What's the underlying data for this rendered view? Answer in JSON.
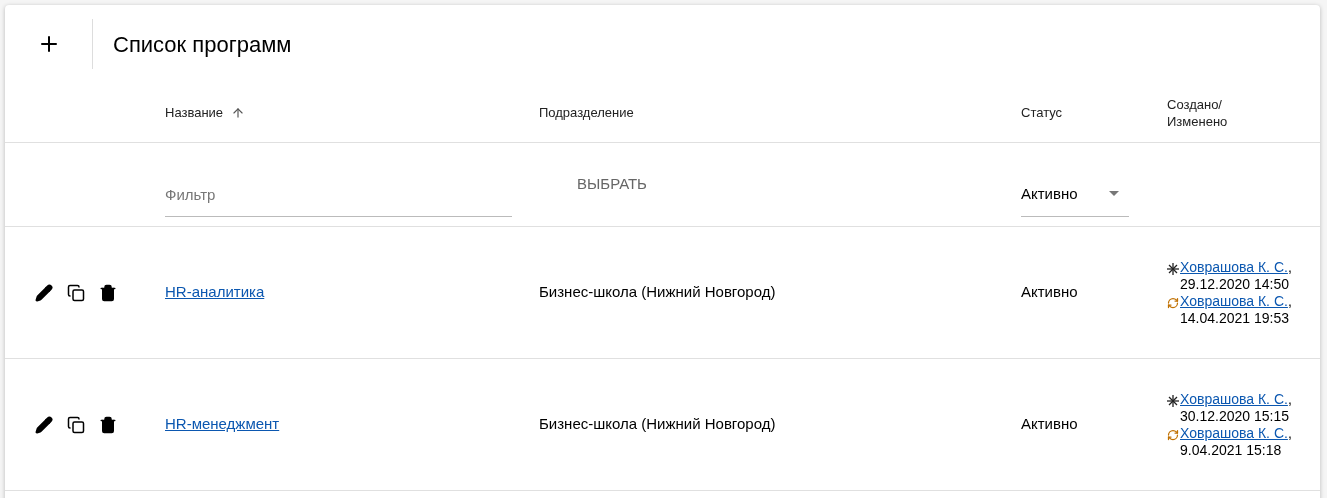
{
  "title": "Список программ",
  "columns": [
    {
      "label": "Название",
      "sorted": true
    },
    {
      "label": "Подразделение",
      "sorted": false
    },
    {
      "label": "Статус",
      "sorted": false
    },
    {
      "label": "Создано/ Изменено",
      "sorted": false
    }
  ],
  "filters": {
    "name": {
      "placeholder": "Фильтр"
    },
    "department": {
      "label": "ВЫБРАТЬ"
    },
    "status": {
      "value": "Активно"
    }
  },
  "rows": [
    {
      "name": "HR-аналитика",
      "department": "Бизнес-школа (Нижний Новгород)",
      "status": "Активно",
      "history": [
        {
          "kind": "created",
          "author": "Ховрашова К. С.",
          "rest": ", 29.12.2020 14:50"
        },
        {
          "kind": "modified",
          "author": "Ховрашова К. С.",
          "rest": ", 14.04.2021 19:53"
        }
      ]
    },
    {
      "name": "HR-менеджмент",
      "department": "Бизнес-школа (Нижний Новгород)",
      "status": "Активно",
      "history": [
        {
          "kind": "created",
          "author": "Ховрашова К. С.",
          "rest": ", 30.12.2020 15:15"
        },
        {
          "kind": "modified",
          "author": "Ховрашова К. С.",
          "rest": ", 9.04.2021 15:18"
        }
      ]
    }
  ]
}
